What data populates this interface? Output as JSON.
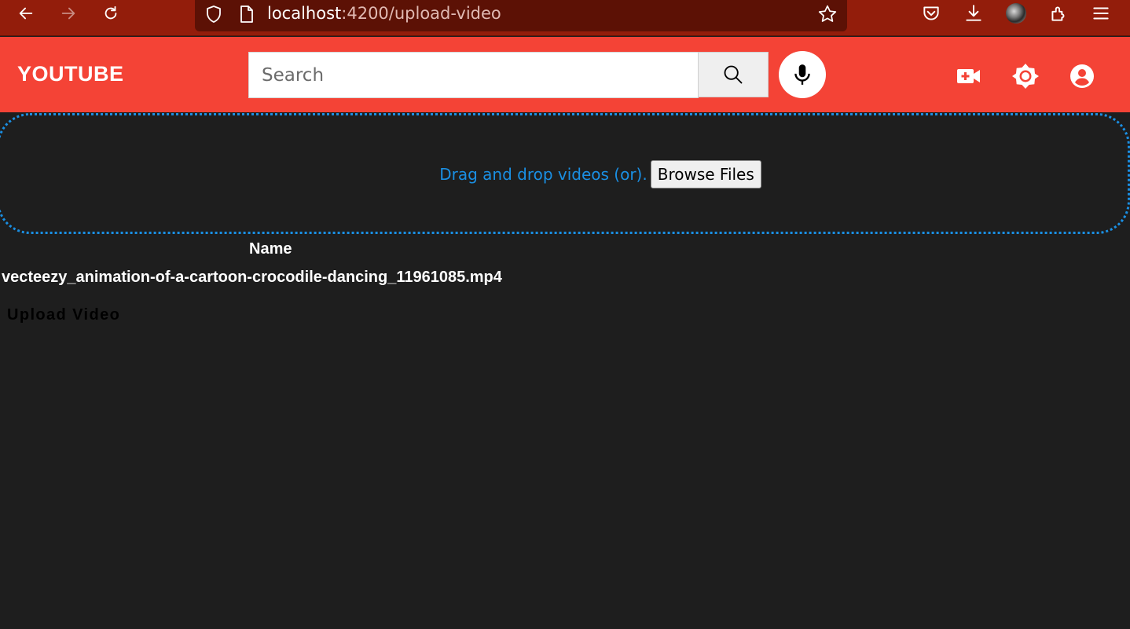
{
  "browser": {
    "url_host": "localhost",
    "url_path": ":4200/upload-video",
    "icons": [
      "back-arrow-icon",
      "forward-arrow-icon",
      "reload-icon",
      "shield-icon",
      "page-icon",
      "bookmark-star-icon",
      "pocket-icon",
      "download-icon",
      "profile-avatar",
      "extensions-icon",
      "menu-icon"
    ],
    "colors": {
      "toolbar": "#931d0b",
      "urlbar": "#5c1105"
    }
  },
  "header": {
    "logo": "YOUTUBE",
    "search_placeholder": "Search",
    "icons": [
      "search-icon",
      "microphone-icon",
      "video-add-icon",
      "brightness-icon",
      "account-icon"
    ],
    "colors": {
      "background": "#f44336"
    }
  },
  "upload": {
    "drop_text": "Drag and drop videos (or).",
    "browse_label": "Browse Files",
    "colors": {
      "accent": "#1a8fe3"
    }
  },
  "files": {
    "column_header": "Name",
    "rows": [
      {
        "name": "vecteezy_animation-of-a-cartoon-crocodile-dancing_11961085.mp4"
      }
    ]
  },
  "actions": {
    "upload_label": "Upload Video"
  }
}
